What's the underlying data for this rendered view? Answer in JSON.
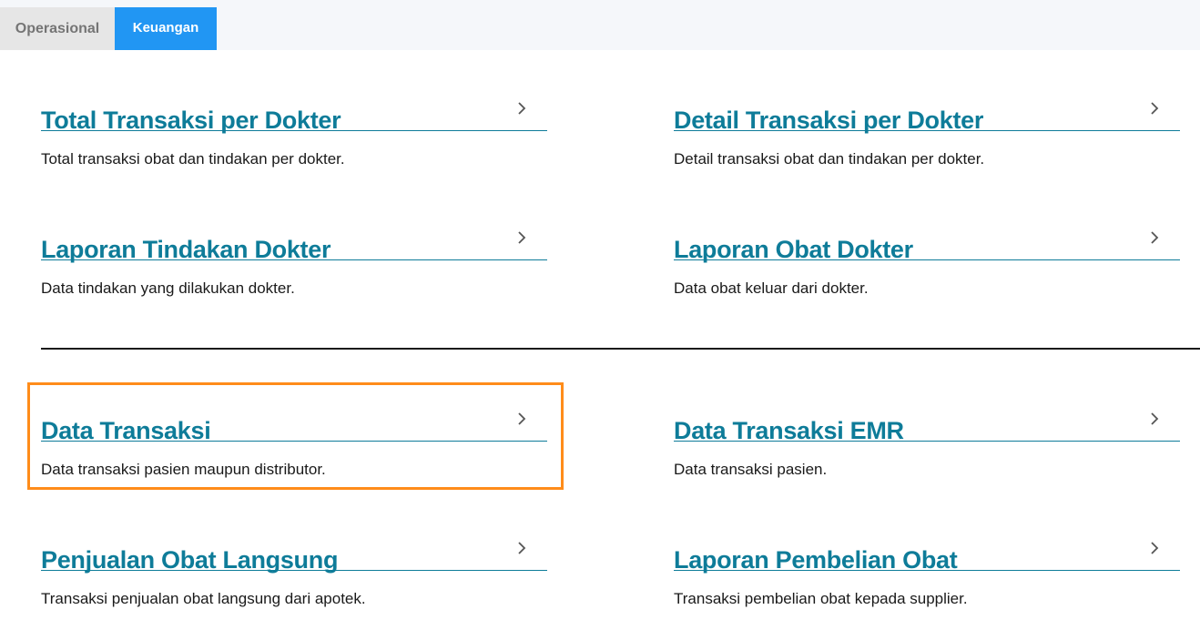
{
  "tabs": [
    {
      "label": "Operasional",
      "active": false
    },
    {
      "label": "Keuangan",
      "active": true
    }
  ],
  "colors": {
    "accent": "#2196f3",
    "title": "#0e7c99",
    "highlight": "#ff8c1a"
  },
  "cards": [
    {
      "title": "Total Transaksi per Dokter",
      "description": "Total transaksi obat dan tindakan per dokter."
    },
    {
      "title": "Detail Transaksi per Dokter",
      "description": "Detail transaksi obat dan tindakan per dokter."
    },
    {
      "title": "Laporan Tindakan Dokter",
      "description": "Data tindakan yang dilakukan dokter."
    },
    {
      "title": "Laporan Obat Dokter",
      "description": "Data obat keluar dari dokter."
    },
    {
      "title": "Data Transaksi",
      "description": "Data transaksi pasien maupun distributor.",
      "highlighted": true
    },
    {
      "title": "Data Transaksi EMR",
      "description": "Data transaksi pasien."
    },
    {
      "title": "Penjualan Obat Langsung",
      "description": "Transaksi penjualan obat langsung dari apotek."
    },
    {
      "title": "Laporan Pembelian Obat",
      "description": "Transaksi pembelian obat kepada supplier."
    }
  ]
}
